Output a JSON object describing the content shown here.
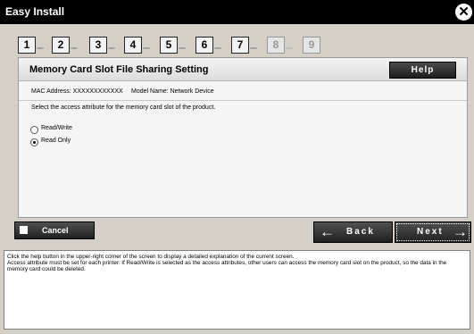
{
  "window": {
    "title": "Easy Install",
    "close_glyph": "✕"
  },
  "steps": [
    {
      "number": "1",
      "enabled": true
    },
    {
      "number": "2",
      "enabled": true
    },
    {
      "number": "3",
      "enabled": true
    },
    {
      "number": "4",
      "enabled": true
    },
    {
      "number": "5",
      "enabled": true
    },
    {
      "number": "6",
      "enabled": true
    },
    {
      "number": "7",
      "enabled": true
    },
    {
      "number": "8",
      "enabled": false
    },
    {
      "number": "9",
      "enabled": false
    }
  ],
  "panel": {
    "title": "Memory Card Slot File Sharing Setting",
    "help_label": "Help",
    "mac_address": "MAC Address: XXXXXXXXXXXX",
    "model_name": "Model Name: Network Device",
    "instruction": "Select the access attribute for the memory card slot of the product.",
    "options": [
      {
        "label": "Read/Write",
        "selected": false
      },
      {
        "label": "Read Only",
        "selected": true
      }
    ]
  },
  "buttons": {
    "cancel": "Cancel",
    "back": "Back",
    "next": "Next",
    "back_arrow": "←",
    "next_arrow": "→"
  },
  "help_text": {
    "line1": "Click the help button in the upper-right corner of the screen to display a detailed explanation of the current screen.",
    "line2": "Access attribute must be set for each printer. If Read/Write is selected as the access attributes, other users can access the memory card slot on the product, so the data in the memory card could be deleted."
  }
}
